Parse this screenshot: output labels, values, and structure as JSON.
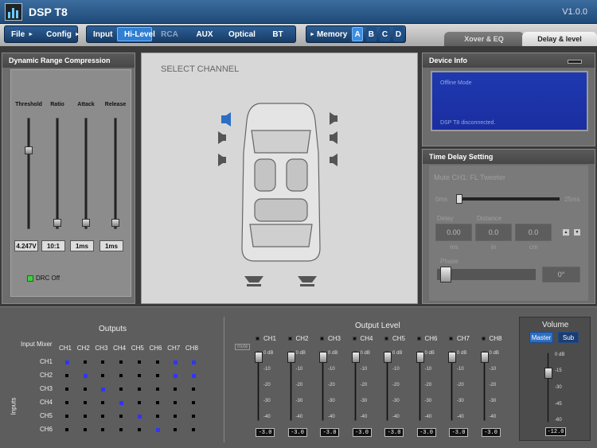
{
  "app": {
    "title": "DSP T8",
    "version": "V1.0.0"
  },
  "toolbar": {
    "file": "File",
    "config": "Config",
    "inputs": [
      "Input",
      "Hi-Level",
      "RCA",
      "AUX",
      "Optical",
      "BT"
    ],
    "memory": "Memory",
    "memory_slots": [
      "A",
      "B",
      "C",
      "D"
    ],
    "tabs": [
      "Xover & EQ",
      "Delay & level"
    ]
  },
  "drc": {
    "title": "Dynamic Range Compression",
    "labels": [
      "Threshold",
      "Ratio",
      "Attack",
      "Release"
    ],
    "values": [
      "4.247V",
      "10:1",
      "1ms",
      "1ms"
    ],
    "status": "DRC Off",
    "status_color": "#44cc44"
  },
  "center": {
    "title": "SELECT CHANNEL"
  },
  "device": {
    "title": "Device Info",
    "line1": "Offline Mode",
    "line2": "DSP T8 disconnected."
  },
  "delay": {
    "title": "Time Delay Setting",
    "mute_label": "Mute CH1: FL Tweeter",
    "min": "0ms",
    "max": "25ms",
    "delay_label": "Delay",
    "distance_label": "Distance",
    "fields": [
      "0.00",
      "0.0",
      "0.0"
    ],
    "units": [
      "ms",
      "in",
      "cm"
    ],
    "phase_label": "Phase",
    "phase_value": "0°"
  },
  "mixer": {
    "title": "Outputs",
    "input_mixer": "Input Mixer",
    "inputs_label": "Inputs",
    "cols": [
      "CH1",
      "CH2",
      "CH3",
      "CH4",
      "CH5",
      "CH6",
      "CH7",
      "CH8"
    ],
    "rows": [
      "CH1",
      "CH2",
      "CH3",
      "CH4",
      "CH5",
      "CH6"
    ]
  },
  "output_level": {
    "title": "Output Level",
    "mute": "mute",
    "channels": [
      "CH1",
      "CH2",
      "CH3",
      "CH4",
      "CH5",
      "CH6",
      "CH7",
      "CH8"
    ],
    "scale": [
      "0 dB",
      "-10",
      "-20",
      "-30",
      "-40"
    ],
    "values": [
      "-3.0",
      "-3.0",
      "-3.0",
      "-3.0",
      "-3.0",
      "-3.0",
      "-3.0",
      "-3.0"
    ]
  },
  "volume": {
    "title": "Volume",
    "master": "Master",
    "sub": "Sub",
    "scale": [
      "0 dB",
      "-15",
      "-30",
      "-45",
      "-60"
    ],
    "value": "-12.0"
  }
}
